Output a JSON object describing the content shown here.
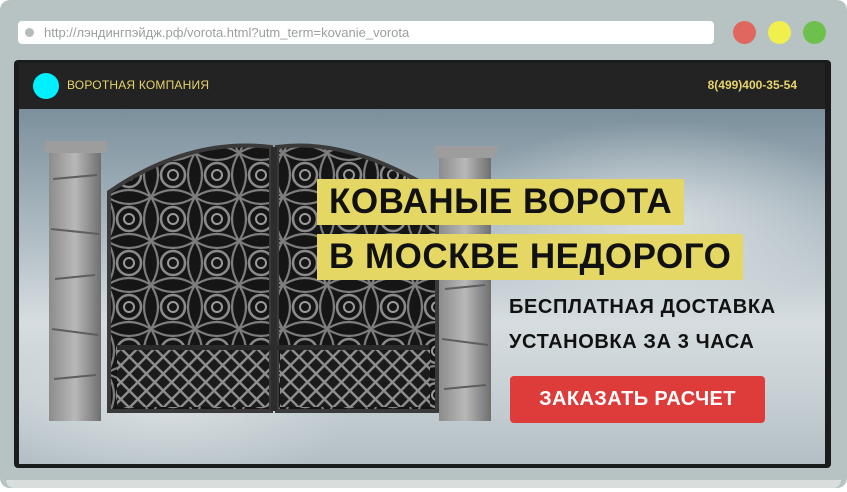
{
  "browser": {
    "url": "http://лэндингпэйдж.рф/vorota.html?utm_term=kovanie_vorota",
    "buttons": [
      {
        "name": "close",
        "color": "#e0675f"
      },
      {
        "name": "minimize",
        "color": "#f1ef4e"
      },
      {
        "name": "maximize",
        "color": "#6ec04d"
      }
    ]
  },
  "header": {
    "company": "ВОРОТНАЯ КОМПАНИЯ",
    "phone": "8(499)400-35-54",
    "logo_color": "#00f0ff",
    "accent_color": "#e6d36a"
  },
  "hero": {
    "headline_line1": "КОВАНЫЕ ВОРОТА",
    "headline_line2": "В МОСКВЕ НЕДОРОГО",
    "headline_bg": "#e4d764",
    "sub_line1": "БЕСПЛАТНАЯ ДОСТАВКА",
    "sub_line2": "УСТАНОВКА ЗА 3 ЧАСА",
    "cta_label": "ЗАКАЗАТЬ РАСЧЕТ",
    "cta_color": "#de3b3b",
    "image": "wrought-iron-gate-with-stone-pillars"
  }
}
